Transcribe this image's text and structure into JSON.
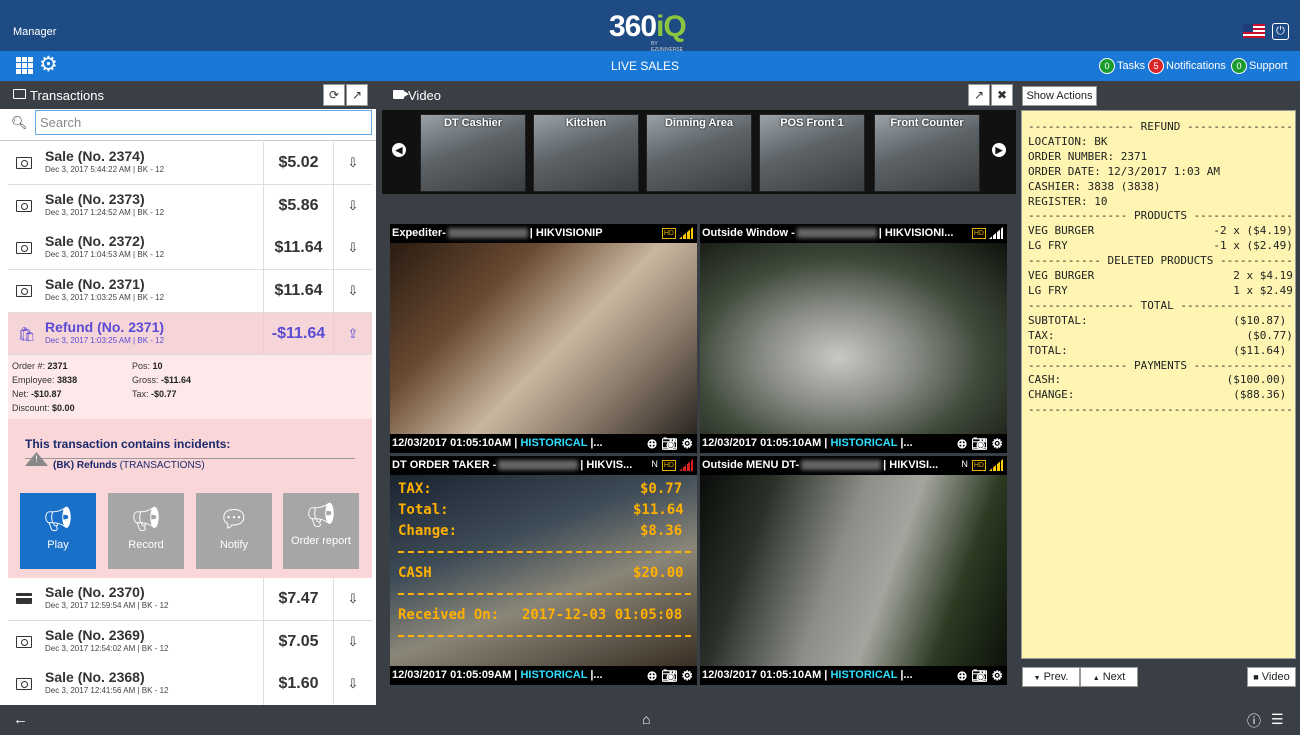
{
  "header": {
    "role": "Manager",
    "logo": "360",
    "logo_suffix": "iQ",
    "logo_sub": "BY EZUNIVERSE",
    "power_icon": "power-icon",
    "flag_icon": "us-flag-icon"
  },
  "nav": {
    "title": "LIVE SALES",
    "tasks": {
      "count": "0",
      "label": "Tasks",
      "color": "#1a9c2f"
    },
    "notifications": {
      "count": "5",
      "label": "Notifications",
      "color": "#d9262b"
    },
    "support": {
      "count": "0",
      "label": "Support",
      "color": "#1a9c2f"
    }
  },
  "transactions": {
    "title": "Transactions",
    "search_placeholder": "Search",
    "rows": [
      {
        "name": "Sale (No. 2374)",
        "date": "Dec 3, 2017 5:44:22 AM | BK - 12",
        "amount": "$5.02"
      },
      {
        "name": "Sale (No. 2373)",
        "date": "Dec 3, 2017 1:24:52 AM | BK - 12",
        "amount": "$5.86"
      },
      {
        "name": "Sale (No. 2372)",
        "date": "Dec 3, 2017 1:04:53 AM | BK - 12",
        "amount": "$11.64"
      },
      {
        "name": "Sale (No. 2371)",
        "date": "Dec 3, 2017 1:03:25 AM | BK - 12",
        "amount": "$11.64"
      }
    ],
    "refund": {
      "name": "Refund (No. 2371)",
      "date": "Dec 3, 2017 1:03:25 AM | BK - 12",
      "amount": "-$11.64"
    },
    "details": {
      "order_label": "Order #:",
      "order": "2371",
      "pos_label": "Pos:",
      "pos": "10",
      "employee_label": "Employee:",
      "employee": "3838",
      "gross_label": "Gross:",
      "gross": "-$11.64",
      "net_label": "Net:",
      "net": "-$10.87",
      "tax_label": "Tax:",
      "tax": "-$0.77",
      "discount_label": "Discount:",
      "discount": "$0.00"
    },
    "incidents": {
      "title": "This transaction contains incidents:",
      "item_bold": "(BK) Refunds",
      "item_rest": " (TRANSACTIONS)"
    },
    "actions": [
      {
        "label": "Play",
        "color": "#1a6fc9"
      },
      {
        "label": "Record",
        "color": "#a6a6a6"
      },
      {
        "label": "Notify",
        "color": "#a6a6a6"
      },
      {
        "label": "Order report",
        "color": "#a6a6a6"
      }
    ],
    "rows_after": [
      {
        "name": "Sale (No. 2370)",
        "date": "Dec 3, 2017 12:59:54 AM | BK - 12",
        "amount": "$7.47"
      },
      {
        "name": "Sale (No. 2369)",
        "date": "Dec 3, 2017 12:54:02 AM | BK - 12",
        "amount": "$7.05"
      },
      {
        "name": "Sale (No. 2368)",
        "date": "Dec 3, 2017 12:41:56 AM | BK - 12",
        "amount": "$1.60"
      }
    ]
  },
  "video": {
    "title": "Video",
    "thumbnails": [
      "DT Cashier",
      "Kitchen",
      "Dinning Area",
      "POS Front 1",
      "Front Counter"
    ],
    "tiles": [
      {
        "name": "Expediter-",
        "source": "| HIKVISIONIP",
        "quality": "HD",
        "timestamp": "12/03/2017 01:05:10AM |",
        "status": "HISTORICAL",
        "sep": "|..."
      },
      {
        "name": "Outside Window -",
        "source": "| HIKVISIONI...",
        "quality": "HD",
        "timestamp": "12/03/2017 01:05:10AM |",
        "status": "HISTORICAL",
        "sep": "|..."
      },
      {
        "name": "DT ORDER TAKER -",
        "source": "| HIKVIS...",
        "quality": "HD",
        "prefix": "N",
        "timestamp": "12/03/2017 01:05:09AM |",
        "status": "HISTORICAL",
        "sep": "|..."
      },
      {
        "name": "Outside MENU DT-",
        "source": "| HIKVISI...",
        "quality": "HD",
        "prefix": "N",
        "timestamp": "12/03/2017 01:05:10AM |",
        "status": "HISTORICAL",
        "sep": "|..."
      }
    ],
    "overlay": {
      "tax": "TAX:",
      "tax_val": "$0.77",
      "total": "Total:",
      "total_val": "$11.64",
      "change": "Change:",
      "change_val": "$8.36",
      "cash": "CASH",
      "cash_val": "$20.00",
      "received": "Received On:",
      "received_val": "2017-12-03 01:05:08"
    }
  },
  "receipt": {
    "show_actions": "Show Actions",
    "text": "---------------- REFUND ----------------\nLOCATION: BK\nORDER NUMBER: 2371\nORDER DATE: 12/3/2017 1:03 AM\nCASHIER: 3838 (3838)\nREGISTER: 10\n--------------- PRODUCTS ---------------\nVEG BURGER                  -2 x ($4.19)\nLG FRY                      -1 x ($2.49)\n----------- DELETED PRODUCTS -----------\nVEG BURGER                     2 x $4.19\nLG FRY                         1 x $2.49\n---------------- TOTAL -----------------\nSUBTOTAL:                      ($10.87)\nTAX:                             ($0.77)\nTOTAL:                         ($11.64)\n--------------- PAYMENTS ---------------\nCASH:                         ($100.00)\nCHANGE:                        ($88.36)\n----------------------------------------",
    "prev": "Prev.",
    "next": "Next",
    "video_btn": "Video"
  }
}
